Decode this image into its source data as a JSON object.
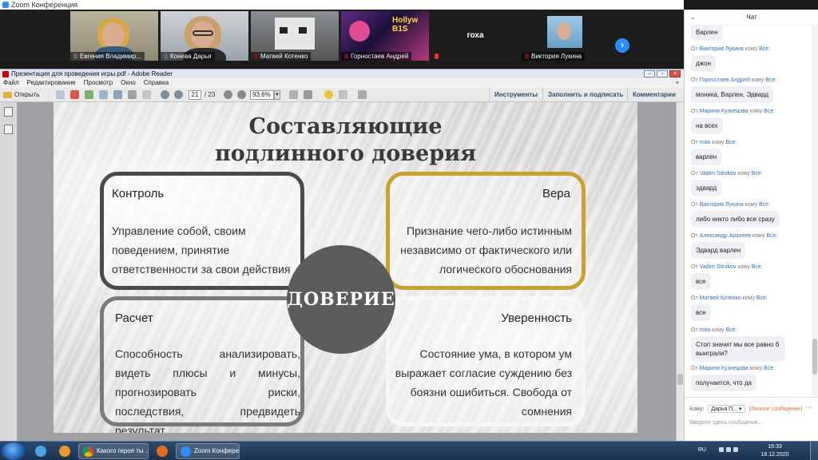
{
  "zoom": {
    "window_title": "Zoom Конференция",
    "participants": [
      {
        "name": "Евгения Владимир...",
        "mic_muted": false
      },
      {
        "name": "Конева Дарья",
        "mic_muted": false
      },
      {
        "name": "Матвей Котенко",
        "mic_muted": true
      },
      {
        "name": "Горностаев Андрей",
        "mic_muted": true
      },
      {
        "name": "",
        "center_label": "гоха",
        "mic_muted": true
      },
      {
        "name": "Виктория Лукина",
        "mic_muted": true
      }
    ],
    "tile4_overlay": "Hollyw B1S"
  },
  "adobe": {
    "window_title": "Презентация для проведения игры.pdf - Adobe Reader",
    "menu": [
      "Файл",
      "Редактирование",
      "Просмотр",
      "Окно",
      "Справка"
    ],
    "menu_right": "×",
    "toolbar": {
      "open_label": "Открыть",
      "page_current": "21",
      "page_total": "/ 23",
      "zoom_value": "93,6%",
      "tools_label": "Инструменты",
      "fill_sign_label": "Заполнить и подписать",
      "comments_label": "Комментарии"
    }
  },
  "slide": {
    "title": "Составляющие подлинного доверия",
    "center": "ДОВЕРИЕ",
    "cards": {
      "control": {
        "heading": "Контроль",
        "body": "Управление собой, своим поведением, принятие ответственности за свои действия"
      },
      "faith": {
        "heading": "Вера",
        "body": "Признание чего-либо истинным независимо от фактического или логического обоснования"
      },
      "calc": {
        "heading": "Расчет",
        "body": "Способность анализировать, видеть плюсы и минусы, прогнозировать риски, последствия, предвидеть результат"
      },
      "confidence": {
        "heading": "Уверенность",
        "body": "Состояние ума, в котором ум выражает согласие суждению без боязни ошибиться. Свобода от сомнения"
      }
    }
  },
  "chat": {
    "title": "Чат",
    "messages": [
      {
        "from": "",
        "to": "",
        "text": "Варлен"
      },
      {
        "from": "Виктория Лукина",
        "to": "Все:",
        "text": "джон"
      },
      {
        "from": "Горностаев Андрей",
        "to": "Все:",
        "text": "моника, Варлен, Эдвард"
      },
      {
        "from": "Марина Кузнецова",
        "to": "Все:",
        "text": "на всех"
      },
      {
        "from": "гоха",
        "to": "Все:",
        "text": "варлен"
      },
      {
        "from": "Vadim Sitnikov",
        "to": "Все:",
        "text": "эдвард"
      },
      {
        "from": "Виктория Лукина",
        "to": "Все:",
        "text": "либо никто либо все сразу"
      },
      {
        "from": "Александр Арахеев",
        "to": "Все:",
        "text": "Эдвард варлен"
      },
      {
        "from": "Vadim Sitnikov",
        "to": "Все:",
        "text": "все"
      },
      {
        "from": "Матвей Котенко",
        "to": "Все:",
        "text": "все"
      },
      {
        "from": "гоха",
        "to": "Все:",
        "text": "Стоп значит мы все равно б выиграли?"
      },
      {
        "from": "Марина Кузнецова",
        "to": "Все:",
        "text": "получается, что да"
      }
    ],
    "from_prefix": "От",
    "to_prefix": "кому",
    "to_label": "Кому:",
    "to_value": "Дарья П...",
    "private_label": "(Личное сообщение)",
    "input_placeholder": "Введите здесь сообщение..."
  },
  "taskbar": {
    "tasks": [
      "Какого героя ты ...",
      "Zoom Конферен..."
    ],
    "lang": "RU",
    "time": "16:33",
    "date": "18.12.2020"
  }
}
